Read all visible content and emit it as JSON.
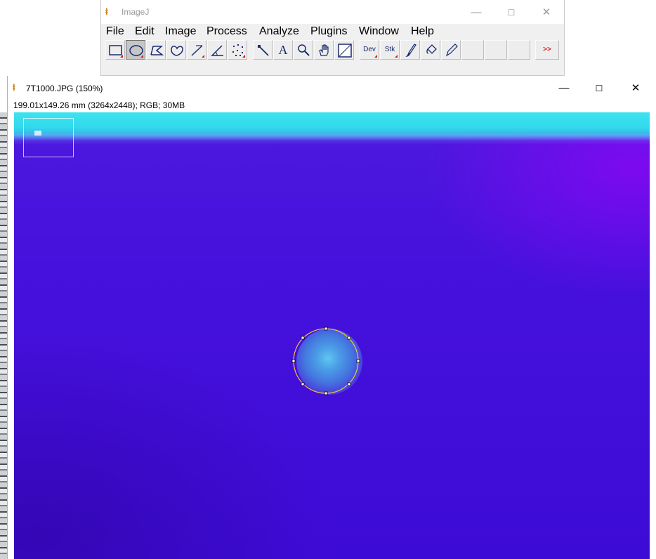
{
  "main_window": {
    "title": "ImageJ",
    "window_controls": {
      "minimize": "—",
      "maximize": "☐",
      "close": "✕"
    },
    "menus": [
      "File",
      "Edit",
      "Image",
      "Process",
      "Analyze",
      "Plugins",
      "Window",
      "Help"
    ],
    "tools": [
      {
        "name": "rectangle-tool",
        "glyph": "",
        "selected": false
      },
      {
        "name": "oval-tool",
        "glyph": "",
        "selected": true
      },
      {
        "name": "polygon-tool",
        "glyph": "",
        "selected": false
      },
      {
        "name": "freehand-tool",
        "glyph": "",
        "selected": false
      },
      {
        "name": "straight-line-tool",
        "glyph": "",
        "selected": false
      },
      {
        "name": "angle-tool",
        "glyph": "",
        "selected": false
      },
      {
        "name": "point-tool",
        "glyph": "",
        "selected": false
      },
      {
        "name": "wand-tool",
        "glyph": "",
        "selected": false
      },
      {
        "name": "text-tool",
        "glyph": "A",
        "selected": false
      },
      {
        "name": "magnifying-glass-tool",
        "glyph": "",
        "selected": false
      },
      {
        "name": "scrolling-tool",
        "glyph": "",
        "selected": false
      },
      {
        "name": "color-picker-tool",
        "glyph": "",
        "selected": false
      },
      {
        "name": "developer-menu-tool",
        "glyph": "Dev",
        "selected": false
      },
      {
        "name": "stack-menu-tool",
        "glyph": "Stk",
        "selected": false
      },
      {
        "name": "brush-tool",
        "glyph": "",
        "selected": false
      },
      {
        "name": "flood-fill-tool",
        "glyph": "",
        "selected": false
      },
      {
        "name": "pencil-tool",
        "glyph": "",
        "selected": false
      },
      {
        "name": "empty-slot-1",
        "glyph": "",
        "selected": false
      },
      {
        "name": "empty-slot-2",
        "glyph": "",
        "selected": false
      },
      {
        "name": "empty-slot-3",
        "glyph": "",
        "selected": false
      },
      {
        "name": "more-tools-button",
        "glyph": ">>",
        "selected": false
      }
    ]
  },
  "image_window": {
    "title": "7T1000.JPG (150%)",
    "info": "199.01x149.26 mm (3264x2448); RGB; 30MB",
    "window_controls": {
      "minimize": "—",
      "maximize": "☐",
      "close": "✕"
    }
  },
  "colors": {
    "background_violet": "#4611dc",
    "top_band_cyan": "#31d9ec",
    "roi_outline": "#f5c242",
    "spot_center": "#5fc7ef",
    "tool_triangle": "#d61c1c"
  }
}
